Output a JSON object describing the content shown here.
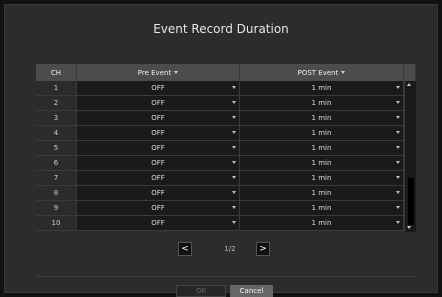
{
  "dialog": {
    "title": "Event Record Duration",
    "columns": {
      "ch": "CH",
      "pre": "Pre Event",
      "post": "POST Event"
    },
    "rows": [
      {
        "ch": "1",
        "pre": "OFF",
        "post": "1 min"
      },
      {
        "ch": "2",
        "pre": "OFF",
        "post": "1 min"
      },
      {
        "ch": "3",
        "pre": "OFF",
        "post": "1 min"
      },
      {
        "ch": "4",
        "pre": "OFF",
        "post": "1 min"
      },
      {
        "ch": "5",
        "pre": "OFF",
        "post": "1 min"
      },
      {
        "ch": "6",
        "pre": "OFF",
        "post": "1 min"
      },
      {
        "ch": "7",
        "pre": "OFF",
        "post": "1 min"
      },
      {
        "ch": "8",
        "pre": "OFF",
        "post": "1 min"
      },
      {
        "ch": "9",
        "pre": "OFF",
        "post": "1 min"
      },
      {
        "ch": "10",
        "pre": "OFF",
        "post": "1 min"
      }
    ],
    "pager": {
      "prev_label": "<",
      "next_label": ">",
      "page_text": "1/2"
    },
    "buttons": {
      "ok": "OK",
      "cancel": "Cancel"
    }
  }
}
